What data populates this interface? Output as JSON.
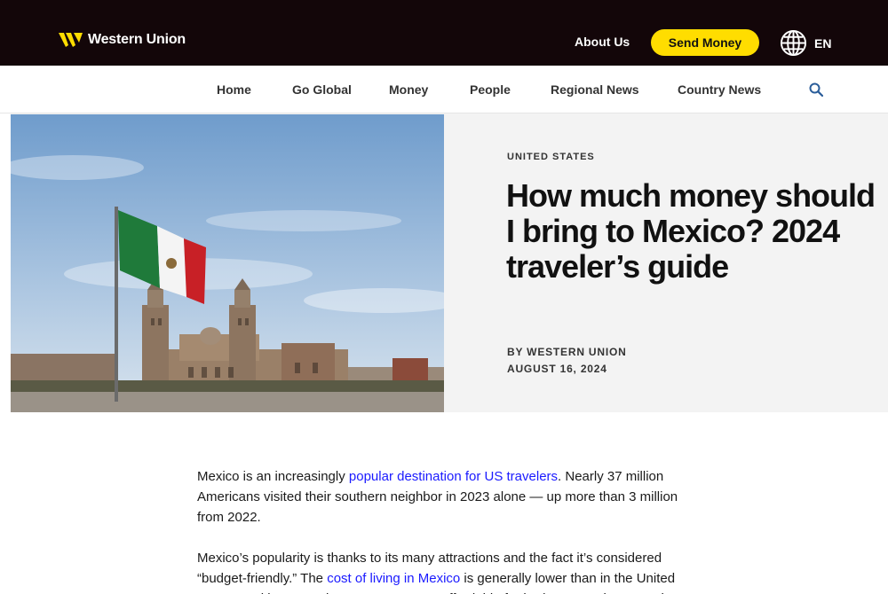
{
  "header": {
    "logo_text": "Western Union",
    "about_label": "About Us",
    "send_money_label": "Send Money",
    "language": "EN"
  },
  "nav": {
    "items": [
      {
        "label": "Home"
      },
      {
        "label": "Go Global"
      },
      {
        "label": "Money"
      },
      {
        "label": "People"
      },
      {
        "label": "Regional News"
      },
      {
        "label": "Country News"
      }
    ]
  },
  "article": {
    "kicker": "UNITED STATES",
    "title": "How much money should I bring to Mexico? 2024 traveler’s guide",
    "byline": "BY WESTERN UNION",
    "date": "AUGUST 16, 2024",
    "para1": {
      "t1": "Mexico is an increasingly ",
      "link1": "popular destination for US travelers",
      "t2": ". Nearly 37 million Americans visited their southern neighbor in 2023 alone — up more than 3 million from 2022."
    },
    "para2": {
      "t1": "Mexico’s popularity is thanks to its many attractions and the fact it’s considered “budget-friendly.” The ",
      "link1": "cost of living in Mexico",
      "t2": " is generally lower than in the United States, making everyday expenses more affordable for budget-conscious travelers."
    }
  },
  "colors": {
    "topbar": "#130609",
    "accent": "#ffdd00",
    "link": "#1a1aff",
    "hero_bg": "#f3f3f3"
  }
}
